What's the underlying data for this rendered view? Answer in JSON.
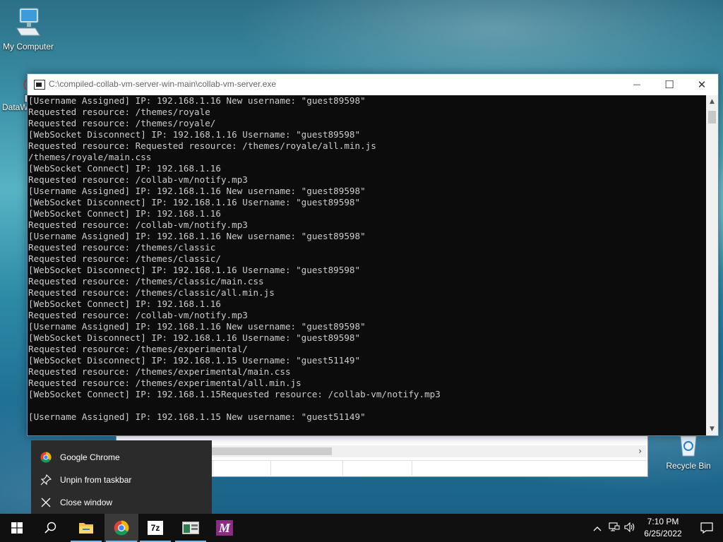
{
  "desktop": {
    "icons": [
      {
        "label": "My Computer"
      },
      {
        "label": "DataW"
      },
      {
        "label": "Recycle Bin"
      }
    ]
  },
  "console": {
    "title": "C:\\compiled-collab-vm-server-win-main\\collab-vm-server.exe",
    "controls": {
      "minimize": "—",
      "maximize": "☐",
      "close": "✕"
    },
    "lines": [
      "[Username Assigned] IP: 192.168.1.16 New username: \"guest89598\"",
      "Requested resource: /themes/royale",
      "Requested resource: /themes/royale/",
      "[WebSocket Disconnect] IP: 192.168.1.16 Username: \"guest89598\"",
      "Requested resource: Requested resource: /themes/royale/all.min.js",
      "/themes/royale/main.css",
      "[WebSocket Connect] IP: 192.168.1.16",
      "Requested resource: /collab-vm/notify.mp3",
      "[Username Assigned] IP: 192.168.1.16 New username: \"guest89598\"",
      "[WebSocket Disconnect] IP: 192.168.1.16 Username: \"guest89598\"",
      "[WebSocket Connect] IP: 192.168.1.16",
      "Requested resource: /collab-vm/notify.mp3",
      "[Username Assigned] IP: 192.168.1.16 New username: \"guest89598\"",
      "Requested resource: /themes/classic",
      "Requested resource: /themes/classic/",
      "[WebSocket Disconnect] IP: 192.168.1.16 Username: \"guest89598\"",
      "Requested resource: /themes/classic/main.css",
      "Requested resource: /themes/classic/all.min.js",
      "[WebSocket Connect] IP: 192.168.1.16",
      "Requested resource: /collab-vm/notify.mp3",
      "[Username Assigned] IP: 192.168.1.16 New username: \"guest89598\"",
      "[WebSocket Disconnect] IP: 192.168.1.16 Username: \"guest89598\"",
      "Requested resource: /themes/experimental/",
      "[WebSocket Disconnect] IP: 192.168.1.15 Username: \"guest51149\"",
      "Requested resource: /themes/experimental/main.css",
      "Requested resource: /themes/experimental/all.min.js",
      "[WebSocket Connect] IP: 192.168.1.15Requested resource: /collab-vm/notify.mp3",
      "",
      "[Username Assigned] IP: 192.168.1.15 New username: \"guest51149\""
    ]
  },
  "jumplist": {
    "items": [
      {
        "label": "Google Chrome",
        "icon": "chrome-icon"
      },
      {
        "label": "Unpin from taskbar",
        "icon": "unpin-icon"
      },
      {
        "label": "Close window",
        "icon": "close-icon"
      }
    ]
  },
  "taskbar": {
    "apps": [
      {
        "name": "start",
        "icon": "windows-logo-icon"
      },
      {
        "name": "search",
        "icon": "search-icon"
      },
      {
        "name": "file-explorer",
        "icon": "folder-icon"
      },
      {
        "name": "chrome",
        "icon": "chrome-icon",
        "active": true
      },
      {
        "name": "7zip",
        "icon": "7zip-icon",
        "label": "7z"
      },
      {
        "name": "console-app",
        "icon": "window-icon"
      },
      {
        "name": "app-m",
        "icon": "m-icon",
        "label": "M"
      }
    ],
    "clock": {
      "time": "7:10 PM",
      "date": "6/25/2022"
    }
  },
  "colors": {
    "console_bg": "#0c0c0c",
    "console_text": "#cccccc",
    "taskbar_bg": "#101010",
    "jumplist_bg": "#2b2b2b",
    "accent": "#76b9ed"
  }
}
